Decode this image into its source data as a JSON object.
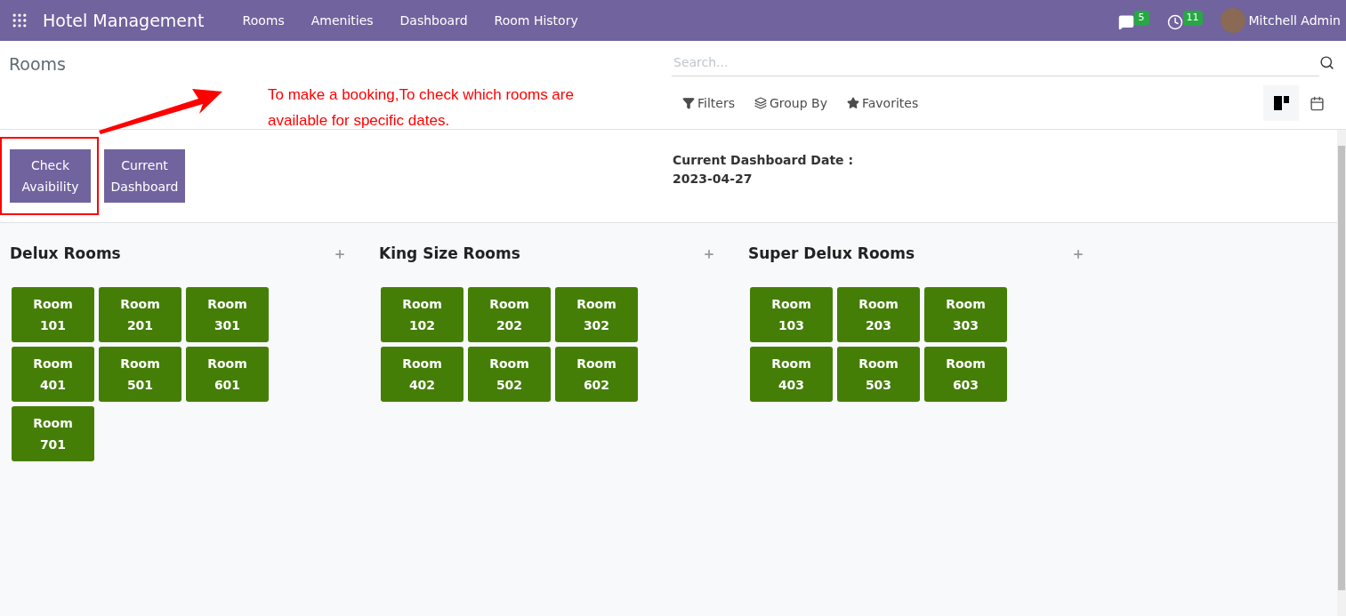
{
  "navbar": {
    "app_title": "Hotel Management",
    "menu": [
      {
        "label": "Rooms"
      },
      {
        "label": "Amenities"
      },
      {
        "label": "Dashboard"
      },
      {
        "label": "Room History"
      }
    ],
    "messages_count": "5",
    "activities_count": "11",
    "user": "Mitchell Admin"
  },
  "control_panel": {
    "breadcrumb": "Rooms",
    "search": {
      "placeholder": "Search..."
    },
    "filters": [
      {
        "kind": "filter",
        "label": "Filters"
      },
      {
        "kind": "group",
        "label": "Group By"
      },
      {
        "kind": "favorite",
        "label": "Favorites"
      }
    ],
    "views": [
      {
        "kind": "kanban",
        "selected": true
      },
      {
        "kind": "calendar",
        "selected": false
      }
    ]
  },
  "annotation": {
    "text": "To make a booking,To check which rooms are available for specific dates."
  },
  "actions": [
    {
      "label": "Check Avaibility",
      "highlighted": true
    },
    {
      "label": "Current Dashboard",
      "highlighted": false
    }
  ],
  "dashboard_date": {
    "label": "Current Dashboard Date :",
    "value": "2023-04-27"
  },
  "groups": [
    {
      "title": "Delux Rooms",
      "rooms": [
        "Room 101",
        "Room 201",
        "Room 301",
        "Room 401",
        "Room 501",
        "Room 601",
        "Room 701"
      ]
    },
    {
      "title": "King Size Rooms",
      "rooms": [
        "Room 102",
        "Room 202",
        "Room 302",
        "Room 402",
        "Room 502",
        "Room 602"
      ]
    },
    {
      "title": "Super Delux Rooms",
      "rooms": [
        "Room 103",
        "Room 203",
        "Room 303",
        "Room 403",
        "Room 503",
        "Room 603"
      ]
    }
  ]
}
